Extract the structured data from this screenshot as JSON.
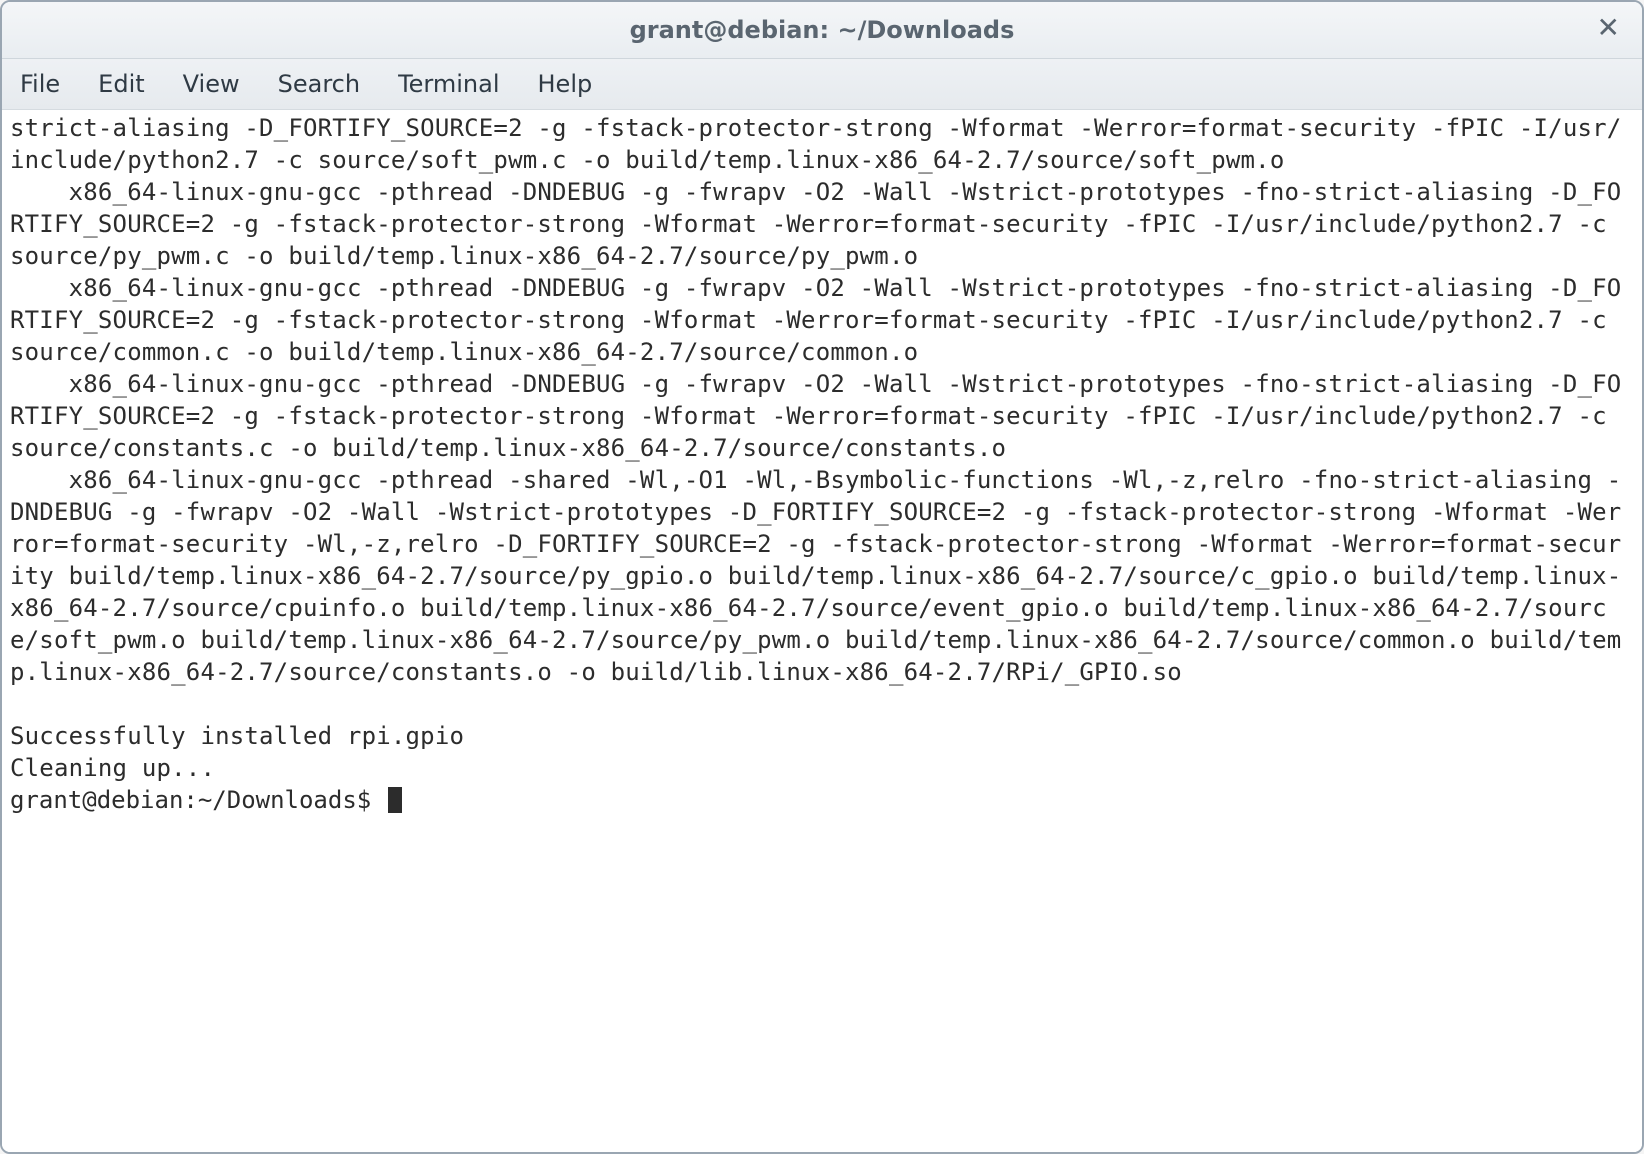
{
  "window": {
    "title": "grant@debian: ~/Downloads"
  },
  "menubar": {
    "items": [
      "File",
      "Edit",
      "View",
      "Search",
      "Terminal",
      "Help"
    ]
  },
  "terminal": {
    "output": "strict-aliasing -D_FORTIFY_SOURCE=2 -g -fstack-protector-strong -Wformat -Werror=format-security -fPIC -I/usr/include/python2.7 -c source/soft_pwm.c -o build/temp.linux-x86_64-2.7/source/soft_pwm.o\n    x86_64-linux-gnu-gcc -pthread -DNDEBUG -g -fwrapv -O2 -Wall -Wstrict-prototypes -fno-strict-aliasing -D_FORTIFY_SOURCE=2 -g -fstack-protector-strong -Wformat -Werror=format-security -fPIC -I/usr/include/python2.7 -c source/py_pwm.c -o build/temp.linux-x86_64-2.7/source/py_pwm.o\n    x86_64-linux-gnu-gcc -pthread -DNDEBUG -g -fwrapv -O2 -Wall -Wstrict-prototypes -fno-strict-aliasing -D_FORTIFY_SOURCE=2 -g -fstack-protector-strong -Wformat -Werror=format-security -fPIC -I/usr/include/python2.7 -c source/common.c -o build/temp.linux-x86_64-2.7/source/common.o\n    x86_64-linux-gnu-gcc -pthread -DNDEBUG -g -fwrapv -O2 -Wall -Wstrict-prototypes -fno-strict-aliasing -D_FORTIFY_SOURCE=2 -g -fstack-protector-strong -Wformat -Werror=format-security -fPIC -I/usr/include/python2.7 -c source/constants.c -o build/temp.linux-x86_64-2.7/source/constants.o\n    x86_64-linux-gnu-gcc -pthread -shared -Wl,-O1 -Wl,-Bsymbolic-functions -Wl,-z,relro -fno-strict-aliasing -DNDEBUG -g -fwrapv -O2 -Wall -Wstrict-prototypes -D_FORTIFY_SOURCE=2 -g -fstack-protector-strong -Wformat -Werror=format-security -Wl,-z,relro -D_FORTIFY_SOURCE=2 -g -fstack-protector-strong -Wformat -Werror=format-security build/temp.linux-x86_64-2.7/source/py_gpio.o build/temp.linux-x86_64-2.7/source/c_gpio.o build/temp.linux-x86_64-2.7/source/cpuinfo.o build/temp.linux-x86_64-2.7/source/event_gpio.o build/temp.linux-x86_64-2.7/source/soft_pwm.o build/temp.linux-x86_64-2.7/source/py_pwm.o build/temp.linux-x86_64-2.7/source/common.o build/temp.linux-x86_64-2.7/source/constants.o -o build/lib.linux-x86_64-2.7/RPi/_GPIO.so\n\nSuccessfully installed rpi.gpio\nCleaning up...",
    "prompt": "grant@debian:~/Downloads$ "
  }
}
